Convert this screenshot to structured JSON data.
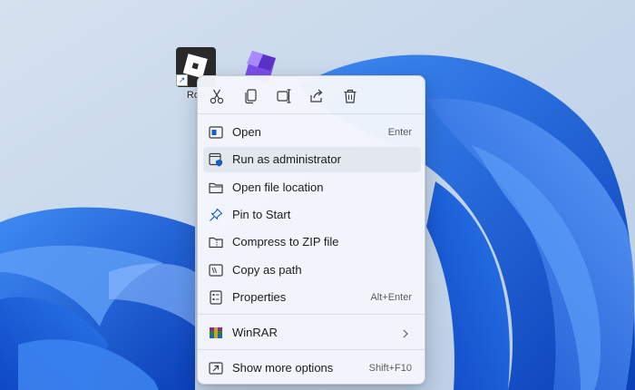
{
  "colors": {
    "wallpaper_bg": "#c9d8ea",
    "bloom_blue": "#1d6fe6",
    "bloom_dark": "#0b3fb0",
    "menu_bg": "#f3f6fb",
    "menu_hover": "#e3e7ee",
    "icon_accent": "#1460c8"
  },
  "desktop": {
    "icons": [
      {
        "label": "Rob",
        "icon": "roblox-icon"
      },
      {
        "label": "",
        "icon": "roblox-studio-icon"
      }
    ]
  },
  "context_menu": {
    "quick_actions": [
      {
        "name": "cut",
        "icon": "scissors-icon"
      },
      {
        "name": "copy",
        "icon": "copy-icon"
      },
      {
        "name": "rename",
        "icon": "rename-icon"
      },
      {
        "name": "share",
        "icon": "share-icon"
      },
      {
        "name": "delete",
        "icon": "trash-icon"
      }
    ],
    "items": [
      {
        "label": "Open",
        "shortcut": "Enter",
        "icon": "open-window-icon"
      },
      {
        "label": "Run as administrator",
        "shortcut": "",
        "icon": "shield-icon",
        "highlighted": true
      },
      {
        "label": "Open file location",
        "shortcut": "",
        "icon": "folder-icon"
      },
      {
        "label": "Pin to Start",
        "shortcut": "",
        "icon": "pin-icon"
      },
      {
        "label": "Compress to ZIP file",
        "shortcut": "",
        "icon": "zip-folder-icon"
      },
      {
        "label": "Copy as path",
        "shortcut": "",
        "icon": "copy-path-icon"
      },
      {
        "label": "Properties",
        "shortcut": "Alt+Enter",
        "icon": "properties-icon"
      },
      {
        "label": "WinRAR",
        "shortcut": "",
        "icon": "winrar-icon",
        "submenu": true
      },
      {
        "label": "Show more options",
        "shortcut": "Shift+F10",
        "icon": "show-more-icon"
      }
    ]
  }
}
